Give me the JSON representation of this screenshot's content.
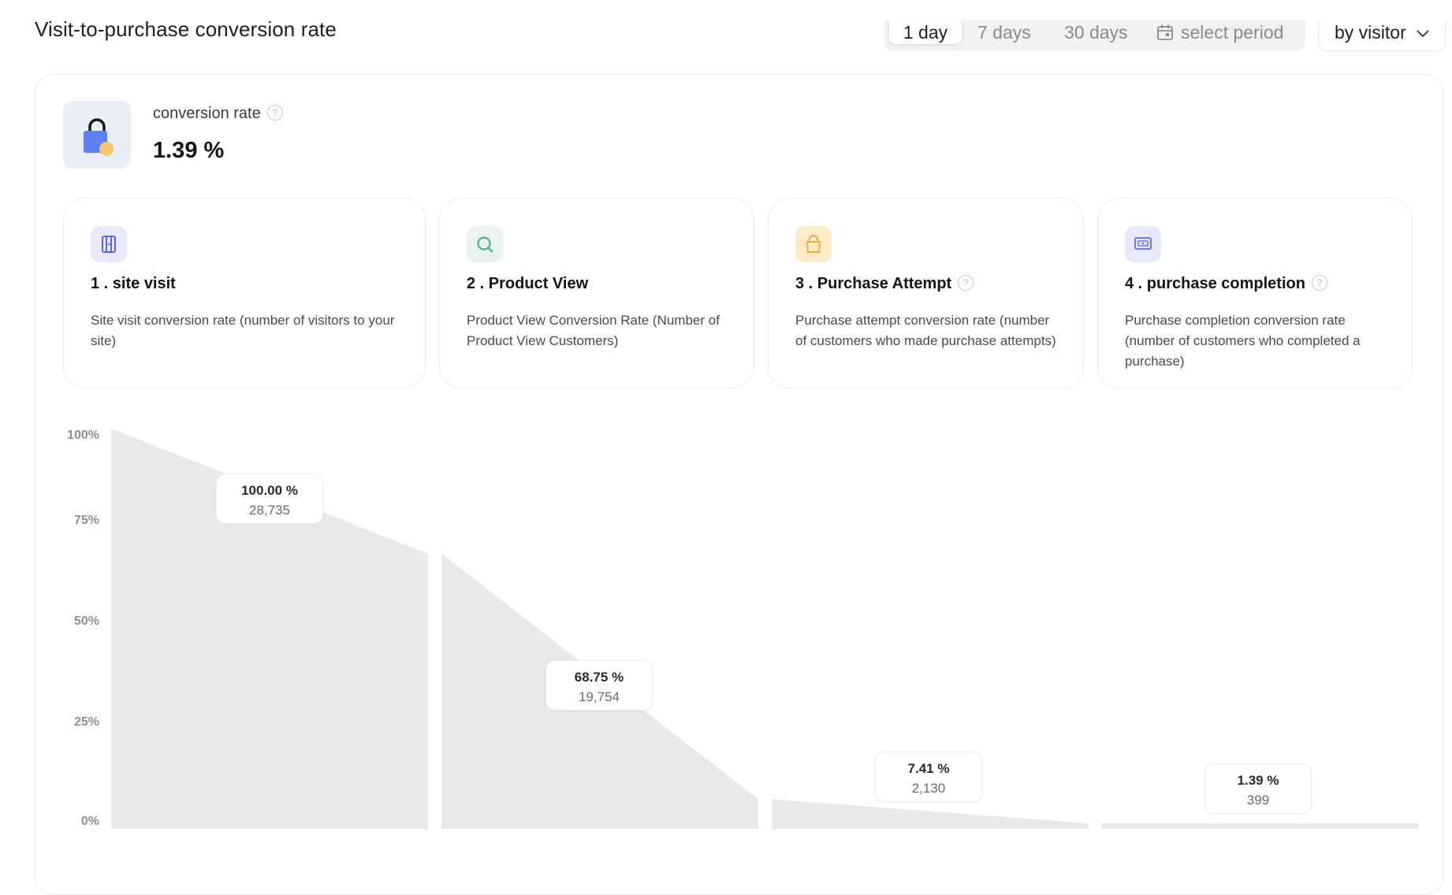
{
  "header": {
    "title": "Visit-to-purchase conversion rate",
    "periods": [
      "1 day",
      "7 days",
      "30 days"
    ],
    "active_period": "1 day",
    "select_period_label": "select period",
    "mode_label": "by visitor"
  },
  "summary": {
    "label": "conversion rate",
    "value": "1.39 %",
    "icon": "shopping-bag-icon",
    "accent_color": "#5b7ef0"
  },
  "steps": [
    {
      "title": "1 . site visit",
      "description": "Site visit conversion rate (number of visitors to your site)",
      "icon": "door-icon",
      "has_help": false,
      "icon_bg": "#e9e8fb",
      "icon_color": "#5b67e0"
    },
    {
      "title": "2 . Product View",
      "description": "Product View Conversion Rate (Number of Product View Customers)",
      "icon": "search-icon",
      "has_help": false,
      "icon_bg": "#e9f2ee",
      "icon_color": "#4fb08a"
    },
    {
      "title": "3 . Purchase Attempt",
      "description": "Purchase attempt conversion rate (number of customers who made purchase attempts)",
      "icon": "bag-icon",
      "has_help": true,
      "icon_bg": "#fdebc8",
      "icon_color": "#f0a93a"
    },
    {
      "title": "4 . purchase completion",
      "description": "Purchase completion conversion rate (number of customers who completed a purchase)",
      "icon": "payment-icon",
      "has_help": true,
      "icon_bg": "#e6e9fb",
      "icon_color": "#6a7ae6"
    }
  ],
  "chart_data": {
    "type": "area",
    "y_ticks": [
      "100%",
      "75%",
      "50%",
      "25%",
      "0%"
    ],
    "ylim": [
      0,
      100
    ],
    "stages": [
      {
        "name": "1 . site visit",
        "start": 100,
        "end": 68.75,
        "label_pct": "100.00 %",
        "label_count": "28,735"
      },
      {
        "name": "2 . Product View",
        "start": 68.75,
        "end": 7.41,
        "label_pct": "68.75 %",
        "label_count": "19,754"
      },
      {
        "name": "3 . Purchase Attempt",
        "start": 7.41,
        "end": 1.39,
        "label_pct": "7.41 %",
        "label_count": "2,130"
      },
      {
        "name": "4 . purchase completion",
        "start": 1.39,
        "end": 1.39,
        "label_pct": "1.39 %",
        "label_count": "399"
      }
    ],
    "fill_color": "#e8e9e9"
  }
}
